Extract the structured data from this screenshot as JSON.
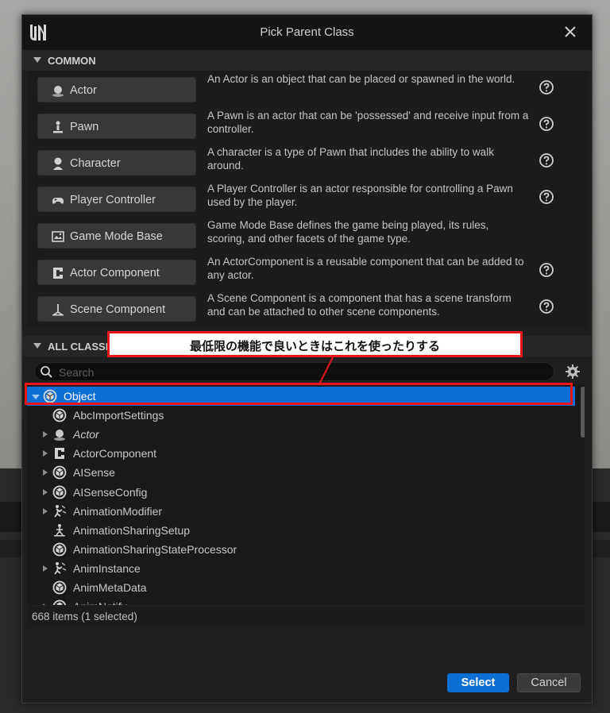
{
  "dialog": {
    "title": "Pick Parent Class",
    "common_header": "COMMON",
    "all_classes_header": "ALL CLASSES"
  },
  "common": [
    {
      "label": "Actor",
      "icon": "actor-sphere-icon",
      "desc": "An Actor is an object that can be placed or spawned in the world.",
      "help": true
    },
    {
      "label": "Pawn",
      "icon": "pawn-icon",
      "desc": "A Pawn is an actor that can be 'possessed' and receive input from a controller.",
      "help": true
    },
    {
      "label": "Character",
      "icon": "character-icon",
      "desc": "A character is a type of Pawn that includes the ability to walk around.",
      "help": true
    },
    {
      "label": "Player Controller",
      "icon": "gamepad-icon",
      "desc": "A Player Controller is an actor responsible for controlling a Pawn used by the player.",
      "help": true
    },
    {
      "label": "Game Mode Base",
      "icon": "game-mode-icon",
      "desc": "Game Mode Base defines the game being played, its rules, scoring, and other facets of the game type.",
      "help": false
    },
    {
      "label": "Actor Component",
      "icon": "actor-component-icon",
      "desc": "An ActorComponent is a reusable component that can be added to any actor.",
      "help": true
    },
    {
      "label": "Scene Component",
      "icon": "scene-component-icon",
      "desc": "A Scene Component is a component that has a scene transform and can be attached to other scene components.",
      "help": true
    }
  ],
  "search": {
    "placeholder": "Search"
  },
  "tree": [
    {
      "label": "Object",
      "icon": "object-class-icon",
      "expander": "open",
      "selected": true,
      "italic": false,
      "level": 0
    },
    {
      "label": "AbcImportSettings",
      "icon": "object-class-icon",
      "expander": "none",
      "selected": false,
      "italic": false,
      "level": 1
    },
    {
      "label": "Actor",
      "icon": "actor-sphere-icon",
      "expander": "closed",
      "selected": false,
      "italic": true,
      "level": 1
    },
    {
      "label": "ActorComponent",
      "icon": "actor-component-icon",
      "expander": "closed",
      "selected": false,
      "italic": false,
      "level": 1
    },
    {
      "label": "AISense",
      "icon": "object-class-icon",
      "expander": "closed",
      "selected": false,
      "italic": false,
      "level": 1
    },
    {
      "label": "AISenseConfig",
      "icon": "object-class-icon",
      "expander": "closed",
      "selected": false,
      "italic": false,
      "level": 1
    },
    {
      "label": "AnimationModifier",
      "icon": "animation-icon",
      "expander": "closed",
      "selected": false,
      "italic": false,
      "level": 1
    },
    {
      "label": "AnimationSharingSetup",
      "icon": "animation-sharing-icon",
      "expander": "none",
      "selected": false,
      "italic": false,
      "level": 1
    },
    {
      "label": "AnimationSharingStateProcessor",
      "icon": "object-class-icon",
      "expander": "none",
      "selected": false,
      "italic": false,
      "level": 1
    },
    {
      "label": "AnimInstance",
      "icon": "animation-icon",
      "expander": "closed",
      "selected": false,
      "italic": false,
      "level": 1
    },
    {
      "label": "AnimMetaData",
      "icon": "object-class-icon",
      "expander": "none",
      "selected": false,
      "italic": false,
      "level": 1
    },
    {
      "label": "AnimNotify",
      "icon": "object-class-icon",
      "expander": "closed",
      "selected": false,
      "italic": false,
      "level": 1
    }
  ],
  "status": {
    "text": "668 items (1 selected)"
  },
  "buttons": {
    "select": "Select",
    "cancel": "Cancel"
  },
  "annotation": {
    "text": "最低限の機能で良いときはこれを使ったりする"
  },
  "colors": {
    "accent": "#0d6fd6",
    "annotation": "#e8141c"
  }
}
